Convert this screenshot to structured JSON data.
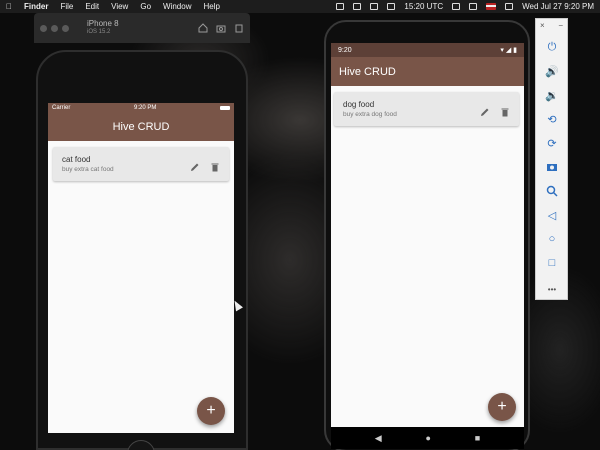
{
  "menubar": {
    "apple": "",
    "items": [
      "Finder",
      "File",
      "Edit",
      "View",
      "Go",
      "Window",
      "Help"
    ],
    "clock_utc": "15:20 UTC",
    "date_time": "Wed Jul 27  9:20 PM"
  },
  "ios_simulator": {
    "device_name": "iPhone 8",
    "os_version": "iOS 15.2",
    "status": {
      "carrier": "Carrier",
      "time": "9:20 PM"
    },
    "app_title": "Hive CRUD",
    "todos": [
      {
        "title": "cat food",
        "subtitle": "buy extra cat food"
      }
    ],
    "fab_label": "+"
  },
  "android_emulator": {
    "status": {
      "time": "9:20"
    },
    "app_title": "Hive CRUD",
    "todos": [
      {
        "title": "dog food",
        "subtitle": "buy extra dog food"
      }
    ],
    "fab_label": "+",
    "nav_icons": [
      "back-icon",
      "home-icon",
      "recents-icon"
    ]
  },
  "emulator_panel": {
    "close_label": "×",
    "minimize_label": "−",
    "more_label": "•••",
    "buttons": [
      "power-icon",
      "volume-up-icon",
      "volume-down-icon",
      "rotate-left-icon",
      "rotate-right-icon",
      "camera-icon",
      "zoom-icon",
      "back-icon",
      "home-icon",
      "overview-icon"
    ]
  },
  "colors": {
    "app_bar": "#795548",
    "android_status": "#5d4037",
    "card_bg": "#e8e8e8",
    "panel_icon": "#2e6fbf"
  }
}
